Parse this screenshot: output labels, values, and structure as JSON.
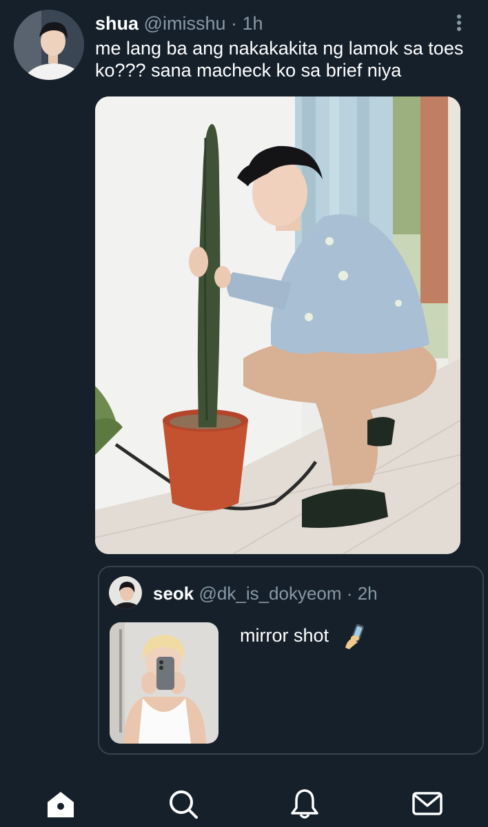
{
  "tweet": {
    "display_name": "shua",
    "handle": "@imisshu",
    "separator": "·",
    "time": "1h",
    "text": "me lang ba ang nakakakita ng lamok sa toes ko??? sana macheck ko sa brief niya",
    "avatar_icon": "user-avatar-photo",
    "media_icon": "photo-man-crouching-by-cactus"
  },
  "quoted_tweet": {
    "display_name": "seok",
    "handle": "@dk_is_dokyeom",
    "separator": "·",
    "time": "2h",
    "text": "mirror shot",
    "emoji_icon": "selfie-emoji",
    "media_icon": "photo-mirror-selfie"
  },
  "bottom_nav": {
    "items": [
      {
        "name": "home",
        "icon": "home-icon",
        "active": true
      },
      {
        "name": "search",
        "icon": "search-icon",
        "active": false
      },
      {
        "name": "notifications",
        "icon": "bell-icon",
        "active": false
      },
      {
        "name": "messages",
        "icon": "mail-icon",
        "active": false
      }
    ]
  },
  "colors": {
    "background": "#15202b",
    "text_primary": "#ffffff",
    "text_secondary": "#8899a6",
    "border": "#38444d"
  }
}
